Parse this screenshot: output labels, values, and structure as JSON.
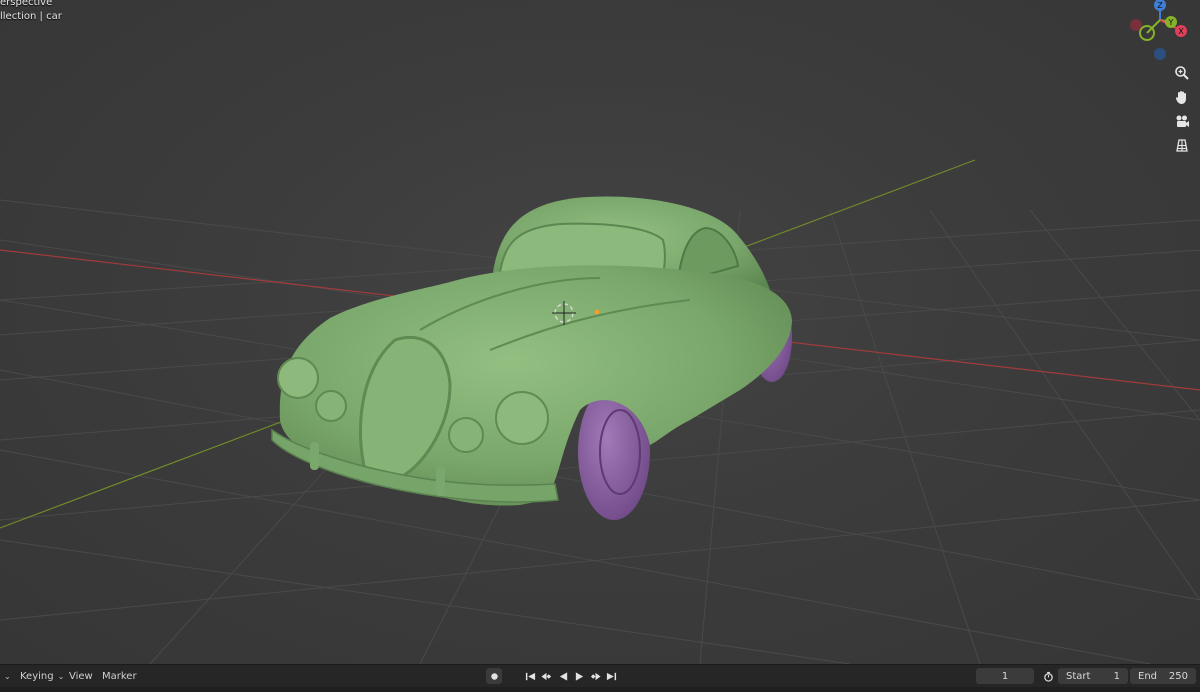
{
  "viewport": {
    "view_name": "erspective",
    "collection_label": "llection | car"
  },
  "gizmo": {
    "axis_z": "Z",
    "axis_y": "Y",
    "axis_x": "X",
    "colors": {
      "x": "#e0415a",
      "y": "#86b32a",
      "z": "#3f7fd8",
      "neg": "#7a2f3c"
    }
  },
  "viewport_tools": [
    "zoom-icon",
    "hand-pan-icon",
    "camera-icon",
    "grid-ortho-icon"
  ],
  "timeline": {
    "menus": [
      {
        "label": "Keying",
        "has_dropdown": true
      },
      {
        "label": "View",
        "has_dropdown": false
      },
      {
        "label": "Marker",
        "has_dropdown": false
      }
    ],
    "current_frame": "1",
    "start_label": "Start",
    "start_value": "1",
    "end_label": "End",
    "end_value": "250"
  },
  "scene": {
    "object": "car",
    "body_color": "#7fab6f",
    "wheel_color": "#8f62a8",
    "x_axis_color": "#a33b3b",
    "y_axis_color": "#6f8a2a"
  }
}
